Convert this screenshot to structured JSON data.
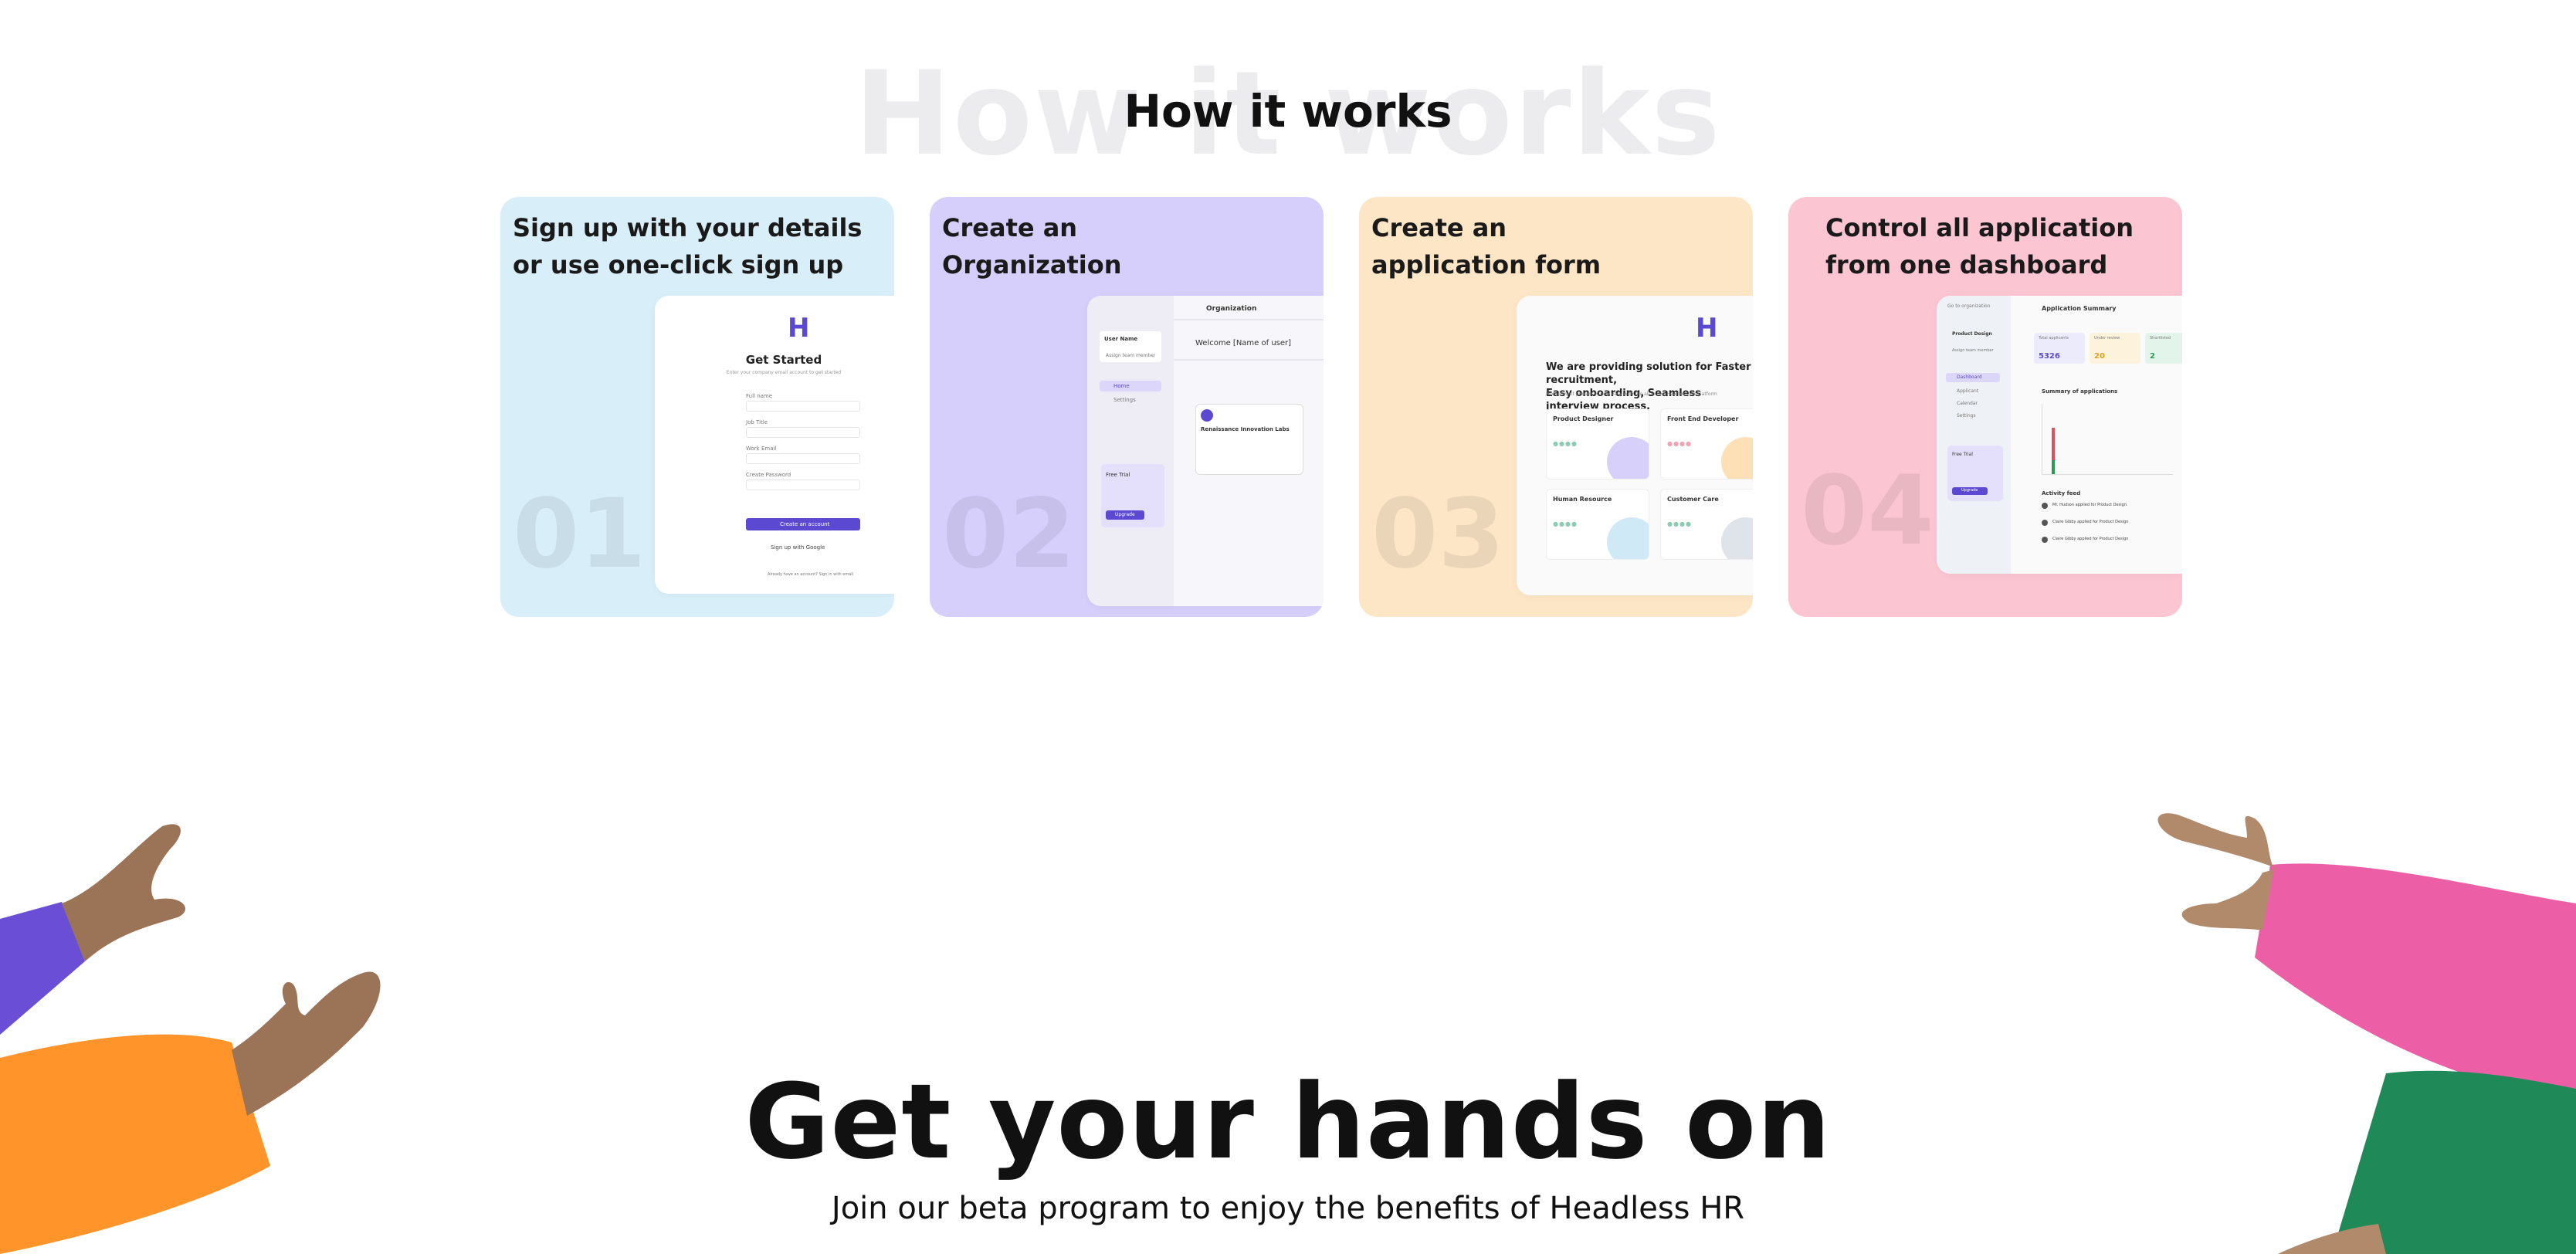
{
  "section": {
    "background_title": "How it works",
    "title": "How it works"
  },
  "steps": [
    {
      "title": "Sign up with your details\nor use one-click sign up",
      "number": "01",
      "color": "#d8eef9",
      "mock": {
        "logo": "H",
        "heading": "Get Started",
        "subheading": "Enter your company email account to get started",
        "fields": [
          "Full name",
          "Job Title",
          "Work Email",
          "Create Password"
        ],
        "button": "Create an account",
        "google": "Sign up with Google",
        "footer": "Already have an account? Sign in with email"
      }
    },
    {
      "title": "Create an\nOrganization",
      "number": "02",
      "color": "#d6cffc",
      "mock": {
        "header": "Organization",
        "user_name": "User Name",
        "assign": "Assign team member",
        "nav": [
          "Home",
          "Settings"
        ],
        "welcome": "Welcome [Name of user]",
        "org_name": "Renaissance Innovation Labs",
        "trial_title": "Free Trial",
        "trial_button": "Upgrade"
      }
    },
    {
      "title": "Create an\napplication form",
      "number": "03",
      "color": "#fde6c6",
      "mock": {
        "heading": "We are providing solution for Faster recruitment,\nEasy onboarding, Seamless interview process.",
        "description": "Recruitment process is now easy with the all in one Headless HR platform",
        "tiles": [
          "Product Designer",
          "Front End Developer",
          "Human Resource",
          "Customer Care"
        ]
      }
    },
    {
      "title": "Control all application\nfrom one dashboard",
      "number": "04",
      "color": "#fbc5d1",
      "mock": {
        "back": "Go to organization",
        "header": "Application Summary",
        "org": "Product Design",
        "assign": "Assign team member",
        "nav": [
          "Dashboard",
          "Applicant",
          "Calendar",
          "Settings"
        ],
        "stats": [
          {
            "label": "Total applicants",
            "value": "5326",
            "color": "#5b4ad1",
            "bg": "#ecebfb"
          },
          {
            "label": "Under review",
            "value": "20",
            "color": "#e0a21e",
            "bg": "#fdf3dd"
          },
          {
            "label": "Shortlisted",
            "value": "2",
            "color": "#2b9a57",
            "bg": "#e3f5ea"
          }
        ],
        "summary_title": "Summary of applications",
        "activity_title": "Activity feed",
        "activity": [
          "Mr. Hudson applied for Product Design",
          "Claire Gibby applied for Product Design",
          "Claire Gibby applied for Product Design"
        ],
        "trial_title": "Free Trial",
        "trial_button": "Upgrade"
      }
    }
  ],
  "cta": {
    "title": "Get your hands on",
    "subtitle": "Join our beta program to enjoy the benefits of Headless HR"
  },
  "colors": {
    "accent": "#5b4ad1",
    "sleeve_purple": "#6a4fd6",
    "sleeve_orange": "#ff952a",
    "sleeve_pink": "#ec5fa6",
    "sleeve_green": "#1f8a57",
    "skin_light": "#b08a6b",
    "skin_dark": "#9b7357"
  }
}
